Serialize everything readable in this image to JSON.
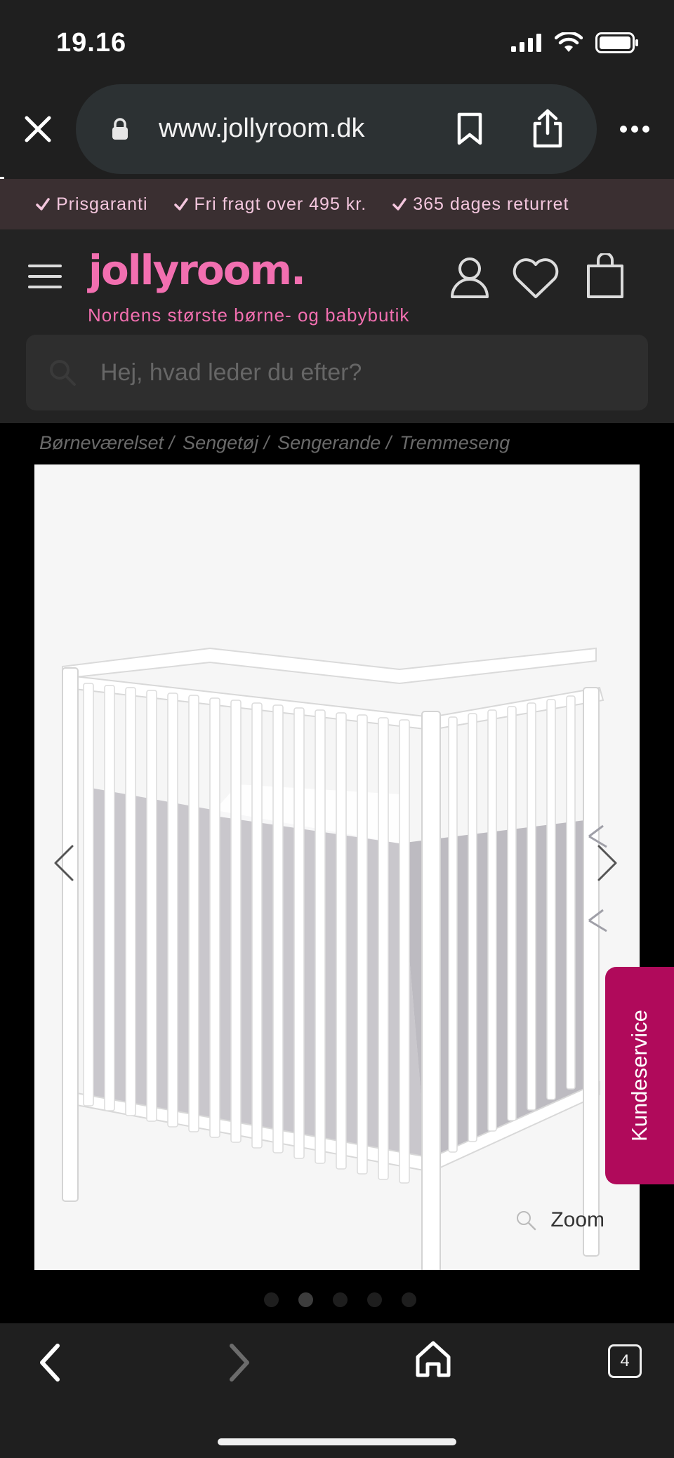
{
  "status": {
    "time": "19.16"
  },
  "browser": {
    "url": "www.jollyroom.dk",
    "tab_count": "4"
  },
  "promo": [
    {
      "label": "Prisgaranti"
    },
    {
      "label": "Fri fragt over 495 kr."
    },
    {
      "label": "365 dages returret"
    }
  ],
  "site": {
    "logo": "jollyroom.",
    "tagline": "Nordens største børne- og babybutik",
    "search_placeholder": "Hej, hvad leder du efter?"
  },
  "breadcrumb": [
    {
      "label": "Børneværelset /"
    },
    {
      "label": "Sengetøj /"
    },
    {
      "label": "Sengerande /"
    },
    {
      "label": "Tremmeseng"
    }
  ],
  "gallery": {
    "zoom_label": "Zoom",
    "slide_count": 5,
    "active_slide": 2
  },
  "support": {
    "label": "Kundeservice"
  },
  "colors": {
    "brand_pink": "#f26fb0",
    "support_magenta": "#b00a5b",
    "promo_bg": "#3a2f31"
  }
}
